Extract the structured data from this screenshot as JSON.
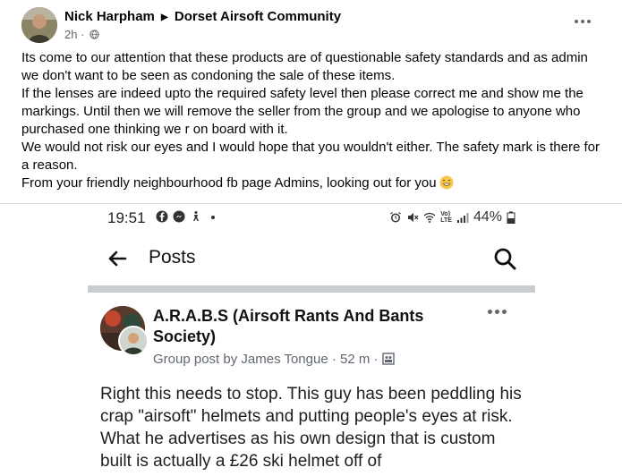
{
  "post": {
    "author": "Nick Harpham",
    "group": "Dorset Airsoft Community",
    "time": "2h",
    "audience_icon": "globe-icon",
    "paragraphs": [
      "Its come to our attention that these products are of questionable safety standards and as admin we don't want to be seen as condoning the sale of these items.",
      "If the lenses are indeed upto the required safety level then please correct me and show me the markings. Until then we will remove the seller from the group and we apologise to anyone who purchased one thinking we r on board with it.",
      "We would not risk our eyes and I would hope that you wouldn't either. The safety mark is there for a reason.",
      "From your friendly neighbourhood fb page Admins, looking out for you"
    ],
    "emoji": "grinning-face-emoji"
  },
  "screenshot": {
    "status_bar": {
      "time": "19:51",
      "battery": "44%",
      "network_label_top": "Vo)",
      "network_label_bottom": "LTE"
    },
    "app_bar": {
      "title": "Posts"
    },
    "inner_post": {
      "group_name": "A.R.A.B.S (Airsoft Rants And Bants Society)",
      "meta": "Group post by James Tongue · 52 m ·",
      "text": "Right this needs to stop. This guy has been peddling his crap \"airsoft\" helmets and putting people's eyes at risk. What he advertises as his own design that is custom built is actually a £26 ski helmet off of"
    }
  },
  "colors": {
    "text_primary": "#050505",
    "text_secondary": "#65676b",
    "divider": "#dadde1",
    "grey_bar": "#c9ccd1"
  }
}
